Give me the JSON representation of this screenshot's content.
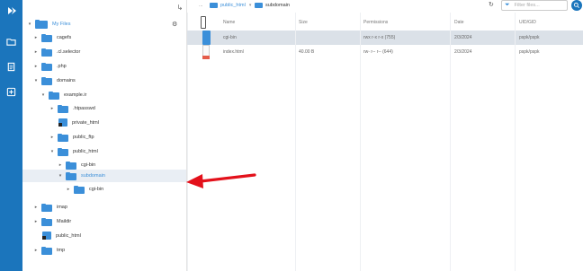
{
  "rail": {
    "logo_icon": "cpanel-logo-icon",
    "buttons": [
      "folder-icon",
      "document-icon",
      "add-icon"
    ],
    "accent": "#1b75bc"
  },
  "tree": {
    "top_icon": "corner-arrow-icon",
    "root": "My Files",
    "items": [
      {
        "label": "cagefs"
      },
      {
        "label": ".cl.selector"
      },
      {
        "label": ".php"
      },
      {
        "label": "domains"
      },
      {
        "label": "example.ir"
      },
      {
        "label": ".htpasswd"
      },
      {
        "label": "private_html"
      },
      {
        "label": "public_ftp"
      },
      {
        "label": "public_html"
      },
      {
        "label": "cgi-bin"
      },
      {
        "label": "subdomain"
      },
      {
        "label": "cgi-bin"
      },
      {
        "label": "imap"
      },
      {
        "label": "Maildir"
      },
      {
        "label": "public_html"
      },
      {
        "label": "tmp"
      }
    ]
  },
  "toolbar": {
    "dots": "...",
    "crumb1": "public_html",
    "crumb2": "subdomain",
    "filter_placeholder": "Filter files..."
  },
  "table": {
    "headers": {
      "name": "Name",
      "size": "Size",
      "permissions": "Permissions",
      "date": "Date",
      "uid": "UID/GID"
    },
    "rows": [
      {
        "name": "cgi-bin",
        "size": "",
        "permissions": "rwx r-x r-x (755)",
        "date": "2/3/2024",
        "uid": "pspk/pspk"
      },
      {
        "name": "index.html",
        "size": "40.00 B",
        "permissions": "rw- r-- r-- (644)",
        "date": "2/3/2024",
        "uid": "pspk/pspk"
      }
    ]
  },
  "colors": {
    "folder": "#3b8fd9",
    "selected_tree": "#e9eef4",
    "selected_row": "#dbe1e8",
    "arrow": "#e3111b"
  }
}
